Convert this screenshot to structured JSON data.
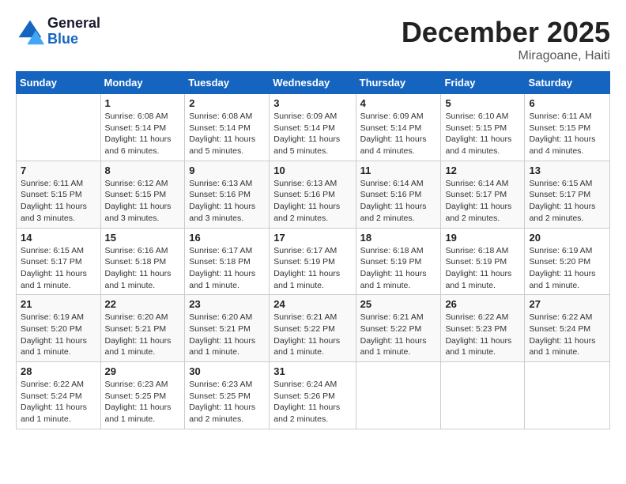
{
  "header": {
    "logo_general": "General",
    "logo_blue": "Blue",
    "month_title": "December 2025",
    "location": "Miragoane, Haiti"
  },
  "days_of_week": [
    "Sunday",
    "Monday",
    "Tuesday",
    "Wednesday",
    "Thursday",
    "Friday",
    "Saturday"
  ],
  "weeks": [
    [
      {
        "num": "",
        "info": ""
      },
      {
        "num": "1",
        "info": "Sunrise: 6:08 AM\nSunset: 5:14 PM\nDaylight: 11 hours and 6 minutes."
      },
      {
        "num": "2",
        "info": "Sunrise: 6:08 AM\nSunset: 5:14 PM\nDaylight: 11 hours and 5 minutes."
      },
      {
        "num": "3",
        "info": "Sunrise: 6:09 AM\nSunset: 5:14 PM\nDaylight: 11 hours and 5 minutes."
      },
      {
        "num": "4",
        "info": "Sunrise: 6:09 AM\nSunset: 5:14 PM\nDaylight: 11 hours and 4 minutes."
      },
      {
        "num": "5",
        "info": "Sunrise: 6:10 AM\nSunset: 5:15 PM\nDaylight: 11 hours and 4 minutes."
      },
      {
        "num": "6",
        "info": "Sunrise: 6:11 AM\nSunset: 5:15 PM\nDaylight: 11 hours and 4 minutes."
      }
    ],
    [
      {
        "num": "7",
        "info": "Sunrise: 6:11 AM\nSunset: 5:15 PM\nDaylight: 11 hours and 3 minutes."
      },
      {
        "num": "8",
        "info": "Sunrise: 6:12 AM\nSunset: 5:15 PM\nDaylight: 11 hours and 3 minutes."
      },
      {
        "num": "9",
        "info": "Sunrise: 6:13 AM\nSunset: 5:16 PM\nDaylight: 11 hours and 3 minutes."
      },
      {
        "num": "10",
        "info": "Sunrise: 6:13 AM\nSunset: 5:16 PM\nDaylight: 11 hours and 2 minutes."
      },
      {
        "num": "11",
        "info": "Sunrise: 6:14 AM\nSunset: 5:16 PM\nDaylight: 11 hours and 2 minutes."
      },
      {
        "num": "12",
        "info": "Sunrise: 6:14 AM\nSunset: 5:17 PM\nDaylight: 11 hours and 2 minutes."
      },
      {
        "num": "13",
        "info": "Sunrise: 6:15 AM\nSunset: 5:17 PM\nDaylight: 11 hours and 2 minutes."
      }
    ],
    [
      {
        "num": "14",
        "info": "Sunrise: 6:15 AM\nSunset: 5:17 PM\nDaylight: 11 hours and 1 minute."
      },
      {
        "num": "15",
        "info": "Sunrise: 6:16 AM\nSunset: 5:18 PM\nDaylight: 11 hours and 1 minute."
      },
      {
        "num": "16",
        "info": "Sunrise: 6:17 AM\nSunset: 5:18 PM\nDaylight: 11 hours and 1 minute."
      },
      {
        "num": "17",
        "info": "Sunrise: 6:17 AM\nSunset: 5:19 PM\nDaylight: 11 hours and 1 minute."
      },
      {
        "num": "18",
        "info": "Sunrise: 6:18 AM\nSunset: 5:19 PM\nDaylight: 11 hours and 1 minute."
      },
      {
        "num": "19",
        "info": "Sunrise: 6:18 AM\nSunset: 5:19 PM\nDaylight: 11 hours and 1 minute."
      },
      {
        "num": "20",
        "info": "Sunrise: 6:19 AM\nSunset: 5:20 PM\nDaylight: 11 hours and 1 minute."
      }
    ],
    [
      {
        "num": "21",
        "info": "Sunrise: 6:19 AM\nSunset: 5:20 PM\nDaylight: 11 hours and 1 minute."
      },
      {
        "num": "22",
        "info": "Sunrise: 6:20 AM\nSunset: 5:21 PM\nDaylight: 11 hours and 1 minute."
      },
      {
        "num": "23",
        "info": "Sunrise: 6:20 AM\nSunset: 5:21 PM\nDaylight: 11 hours and 1 minute."
      },
      {
        "num": "24",
        "info": "Sunrise: 6:21 AM\nSunset: 5:22 PM\nDaylight: 11 hours and 1 minute."
      },
      {
        "num": "25",
        "info": "Sunrise: 6:21 AM\nSunset: 5:22 PM\nDaylight: 11 hours and 1 minute."
      },
      {
        "num": "26",
        "info": "Sunrise: 6:22 AM\nSunset: 5:23 PM\nDaylight: 11 hours and 1 minute."
      },
      {
        "num": "27",
        "info": "Sunrise: 6:22 AM\nSunset: 5:24 PM\nDaylight: 11 hours and 1 minute."
      }
    ],
    [
      {
        "num": "28",
        "info": "Sunrise: 6:22 AM\nSunset: 5:24 PM\nDaylight: 11 hours and 1 minute."
      },
      {
        "num": "29",
        "info": "Sunrise: 6:23 AM\nSunset: 5:25 PM\nDaylight: 11 hours and 1 minute."
      },
      {
        "num": "30",
        "info": "Sunrise: 6:23 AM\nSunset: 5:25 PM\nDaylight: 11 hours and 2 minutes."
      },
      {
        "num": "31",
        "info": "Sunrise: 6:24 AM\nSunset: 5:26 PM\nDaylight: 11 hours and 2 minutes."
      },
      {
        "num": "",
        "info": ""
      },
      {
        "num": "",
        "info": ""
      },
      {
        "num": "",
        "info": ""
      }
    ]
  ]
}
